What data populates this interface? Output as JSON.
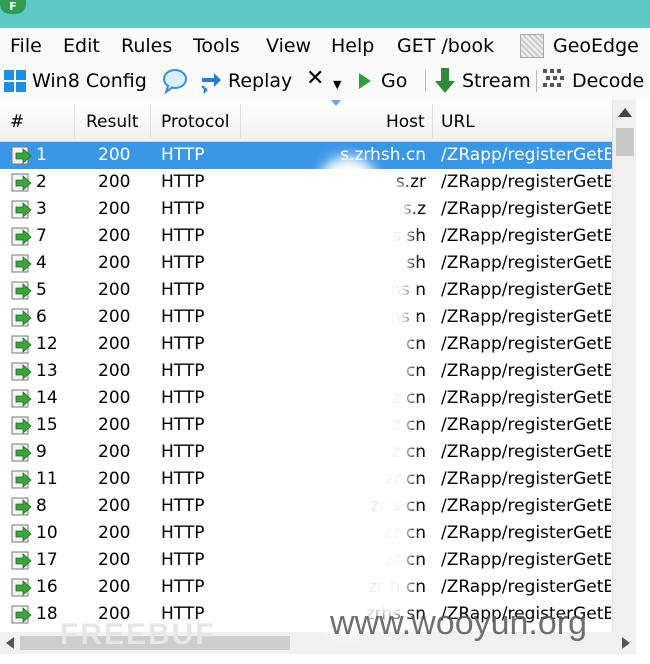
{
  "app": {
    "icon_letter": "F"
  },
  "menu": {
    "items": [
      "File",
      "Edit",
      "Rules",
      "Tools",
      "View",
      "Help",
      "GET /book",
      "GeoEdge"
    ]
  },
  "toolbar": {
    "win8_config": "Win8 Config",
    "replay": "Replay",
    "remove_glyph": "✕",
    "go": "Go",
    "stream": "Stream",
    "decode": "Decode"
  },
  "columns": {
    "num": "#",
    "result": "Result",
    "protocol": "Protocol",
    "host": "Host",
    "url": "URL"
  },
  "sessions": [
    {
      "num": "1",
      "result": "200",
      "protocol": "HTTP",
      "host": "s.zrhsh.cn",
      "url": "/ZRapp/registerGetBo"
    },
    {
      "num": "2",
      "result": "200",
      "protocol": "HTTP",
      "host": "s.zr",
      "url": "/ZRapp/registerGetBo"
    },
    {
      "num": "3",
      "result": "200",
      "protocol": "HTTP",
      "host": "s.z",
      "url": "/ZRapp/registerGetBo"
    },
    {
      "num": "7",
      "result": "200",
      "protocol": "HTTP",
      "host": "s       sh",
      "url": "/ZRapp/registerGetBo"
    },
    {
      "num": "4",
      "result": "200",
      "protocol": "HTTP",
      "host": "sh",
      "url": "/ZRapp/registerGetBo"
    },
    {
      "num": "5",
      "result": "200",
      "protocol": "HTTP",
      "host": "ns     n",
      "url": "/ZRapp/registerGetBo"
    },
    {
      "num": "6",
      "result": "200",
      "protocol": "HTTP",
      "host": "ns     n",
      "url": "/ZRapp/registerGetBo"
    },
    {
      "num": "12",
      "result": "200",
      "protocol": "HTTP",
      "host": "cn",
      "url": "/ZRapp/registerGetBo"
    },
    {
      "num": "13",
      "result": "200",
      "protocol": "HTTP",
      "host": "cn",
      "url": "/ZRapp/registerGetBo"
    },
    {
      "num": "14",
      "result": "200",
      "protocol": "HTTP",
      "host": "z        cn",
      "url": "/ZRapp/registerGetBo"
    },
    {
      "num": "15",
      "result": "200",
      "protocol": "HTTP",
      "host": "z        cn",
      "url": "/ZRapp/registerGetBo"
    },
    {
      "num": "9",
      "result": "200",
      "protocol": "HTTP",
      "host": "z        cn",
      "url": "/ZRapp/registerGetBo"
    },
    {
      "num": "11",
      "result": "200",
      "protocol": "HTTP",
      "host": "zr       cn",
      "url": "/ZRapp/registerGetBo"
    },
    {
      "num": "8",
      "result": "200",
      "protocol": "HTTP",
      "host": "zr   s   cn",
      "url": "/ZRapp/registerGetBo"
    },
    {
      "num": "10",
      "result": "200",
      "protocol": "HTTP",
      "host": "zr       cn",
      "url": "/ZRapp/registerGetBo"
    },
    {
      "num": "17",
      "result": "200",
      "protocol": "HTTP",
      "host": "zr       cn",
      "url": "/ZRapp/registerGetBo"
    },
    {
      "num": "16",
      "result": "200",
      "protocol": "HTTP",
      "host": "zr   h  cn",
      "url": "/ZRapp/registerGetBo"
    },
    {
      "num": "18",
      "result": "200",
      "protocol": "HTTP",
      "host": "zrhs    sn",
      "url": "/ZRapp/registerGetBo"
    }
  ],
  "selected_index": 0,
  "watermarks": {
    "main": "www.wooyun.org",
    "faint": "FREEBUF"
  },
  "colors": {
    "titlebar": "#5ec8c4",
    "selection": "#3a97e6",
    "session_icon": "#3da33d"
  }
}
